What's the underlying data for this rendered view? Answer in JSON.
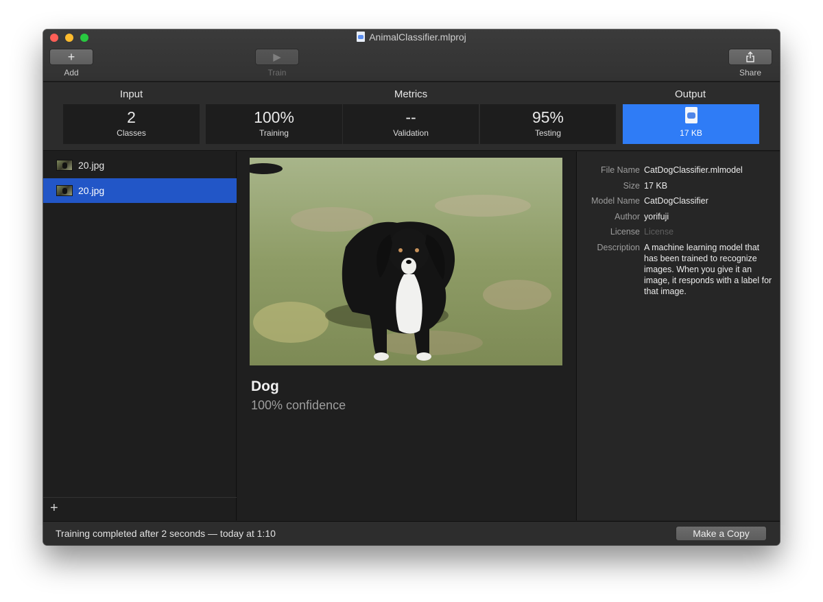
{
  "window": {
    "title": "AnimalClassifier.mlproj"
  },
  "toolbar": {
    "add": {
      "icon": "+",
      "label": "Add"
    },
    "train": {
      "icon": "▶",
      "label": "Train"
    },
    "share": {
      "label": "Share"
    }
  },
  "sections": {
    "input": "Input",
    "metrics": "Metrics",
    "output": "Output"
  },
  "stats": {
    "classes": {
      "value": "2",
      "label": "Classes"
    },
    "training": {
      "value": "100%",
      "label": "Training"
    },
    "validation": {
      "value": "--",
      "label": "Validation"
    },
    "testing": {
      "value": "95%",
      "label": "Testing"
    },
    "output": {
      "value": "17 KB"
    }
  },
  "files": [
    {
      "name": "20.jpg",
      "selected": false
    },
    {
      "name": "20.jpg",
      "selected": true
    }
  ],
  "sidebar": {
    "add_icon": "+"
  },
  "prediction": {
    "label": "Dog",
    "confidence": "100% confidence"
  },
  "info": [
    {
      "key": "File Name",
      "value": "CatDogClassifier.mlmodel"
    },
    {
      "key": "Size",
      "value": "17 KB"
    },
    {
      "key": "Model Name",
      "value": "CatDogClassifier"
    },
    {
      "key": "Author",
      "value": "yorifuji"
    },
    {
      "key": "License",
      "value": "License"
    },
    {
      "key": "Description",
      "value": "A machine learning model that has been trained to recognize images. When you give it an image, it responds with a label for that image."
    }
  ],
  "status": {
    "text": "Training completed after 2 seconds — today at 1:10",
    "copy_button": "Make a Copy"
  },
  "colors": {
    "accent": "#2f7cf6",
    "selection": "#2256c7",
    "traffic_red": "#ff5f57",
    "traffic_yellow": "#febc2e",
    "traffic_green": "#28c840"
  }
}
